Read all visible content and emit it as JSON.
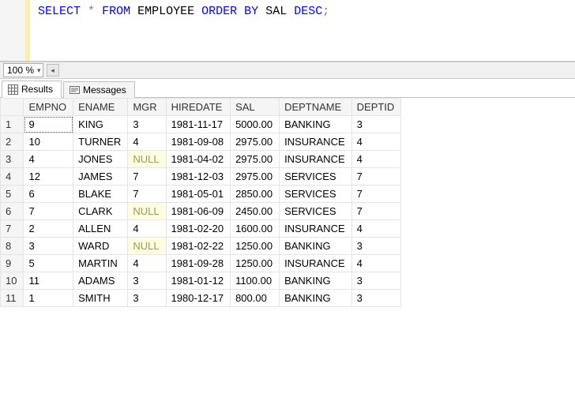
{
  "editor": {
    "tokens": [
      {
        "t": "SELECT",
        "c": "kw"
      },
      {
        "t": " ",
        "c": ""
      },
      {
        "t": "*",
        "c": "star"
      },
      {
        "t": " ",
        "c": ""
      },
      {
        "t": "FROM",
        "c": "kw"
      },
      {
        "t": " ",
        "c": ""
      },
      {
        "t": "EMPLOYEE",
        "c": "ident"
      },
      {
        "t": " ",
        "c": ""
      },
      {
        "t": "ORDER",
        "c": "kw"
      },
      {
        "t": " ",
        "c": ""
      },
      {
        "t": "BY",
        "c": "kw"
      },
      {
        "t": " ",
        "c": ""
      },
      {
        "t": "SAL",
        "c": "ident"
      },
      {
        "t": " ",
        "c": ""
      },
      {
        "t": "DESC",
        "c": "kw"
      },
      {
        "t": ";",
        "c": "semi"
      }
    ]
  },
  "zoom": {
    "value": "100 %"
  },
  "tabs": {
    "results_label": "Results",
    "messages_label": "Messages",
    "active": "results"
  },
  "grid": {
    "columns": [
      "EMPNO",
      "ENAME",
      "MGR",
      "HIREDATE",
      "SAL",
      "DEPTNAME",
      "DEPTID"
    ],
    "null_label": "NULL",
    "rows": [
      {
        "n": 1,
        "EMPNO": "9",
        "ENAME": "KING",
        "MGR": "3",
        "HIREDATE": "1981-11-17",
        "SAL": "5000.00",
        "DEPTNAME": "BANKING",
        "DEPTID": "3",
        "sel": true
      },
      {
        "n": 2,
        "EMPNO": "10",
        "ENAME": "TURNER",
        "MGR": "4",
        "HIREDATE": "1981-09-08",
        "SAL": "2975.00",
        "DEPTNAME": "INSURANCE",
        "DEPTID": "4"
      },
      {
        "n": 3,
        "EMPNO": "4",
        "ENAME": "JONES",
        "MGR": null,
        "HIREDATE": "1981-04-02",
        "SAL": "2975.00",
        "DEPTNAME": "INSURANCE",
        "DEPTID": "4"
      },
      {
        "n": 4,
        "EMPNO": "12",
        "ENAME": "JAMES",
        "MGR": "7",
        "HIREDATE": "1981-12-03",
        "SAL": "2975.00",
        "DEPTNAME": "SERVICES",
        "DEPTID": "7"
      },
      {
        "n": 5,
        "EMPNO": "6",
        "ENAME": "BLAKE",
        "MGR": "7",
        "HIREDATE": "1981-05-01",
        "SAL": "2850.00",
        "DEPTNAME": "SERVICES",
        "DEPTID": "7"
      },
      {
        "n": 6,
        "EMPNO": "7",
        "ENAME": "CLARK",
        "MGR": null,
        "HIREDATE": "1981-06-09",
        "SAL": "2450.00",
        "DEPTNAME": "SERVICES",
        "DEPTID": "7"
      },
      {
        "n": 7,
        "EMPNO": "2",
        "ENAME": "ALLEN",
        "MGR": "4",
        "HIREDATE": "1981-02-20",
        "SAL": "1600.00",
        "DEPTNAME": "INSURANCE",
        "DEPTID": "4"
      },
      {
        "n": 8,
        "EMPNO": "3",
        "ENAME": "WARD",
        "MGR": null,
        "HIREDATE": "1981-02-22",
        "SAL": "1250.00",
        "DEPTNAME": "BANKING",
        "DEPTID": "3"
      },
      {
        "n": 9,
        "EMPNO": "5",
        "ENAME": "MARTIN",
        "MGR": "4",
        "HIREDATE": "1981-09-28",
        "SAL": "1250.00",
        "DEPTNAME": "INSURANCE",
        "DEPTID": "4"
      },
      {
        "n": 10,
        "EMPNO": "11",
        "ENAME": "ADAMS",
        "MGR": "3",
        "HIREDATE": "1981-01-12",
        "SAL": "1100.00",
        "DEPTNAME": "BANKING",
        "DEPTID": "3"
      },
      {
        "n": 11,
        "EMPNO": "1",
        "ENAME": "SMITH",
        "MGR": "3",
        "HIREDATE": "1980-12-17",
        "SAL": "800.00",
        "DEPTNAME": "BANKING",
        "DEPTID": "3"
      }
    ]
  }
}
